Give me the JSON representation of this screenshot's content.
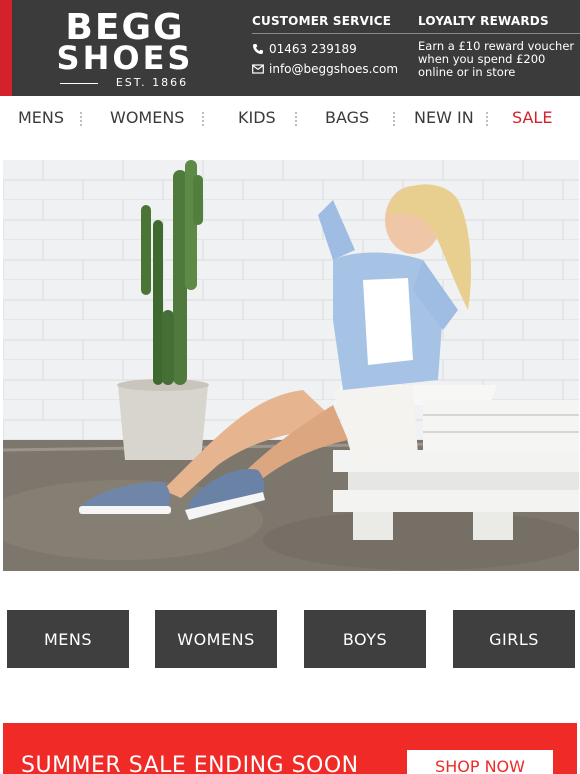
{
  "brand": {
    "line1": "BEGG",
    "line2": "SHOES",
    "est": "EST. 1866"
  },
  "customer_service": {
    "title": "CUSTOMER SERVICE",
    "phone": "01463 239189",
    "email": "info@beggshoes.com"
  },
  "loyalty": {
    "title": "LOYALTY REWARDS",
    "text": "Earn a £10 reward voucher when you spend £200 online or in store"
  },
  "nav": {
    "items": [
      "MENS",
      "WOMENS",
      "KIDS",
      "BAGS",
      "NEW IN",
      "SALE"
    ]
  },
  "categories": [
    "MENS",
    "WOMENS",
    "BOYS",
    "GIRLS"
  ],
  "banner": {
    "text": "SUMMER SALE ENDING SOON",
    "button": "SHOP NOW"
  },
  "colors": {
    "header_bg": "#3b3b3b",
    "accent_red": "#d4212b",
    "banner_red": "#ef2a27",
    "button_dark": "#3f3f3f"
  }
}
